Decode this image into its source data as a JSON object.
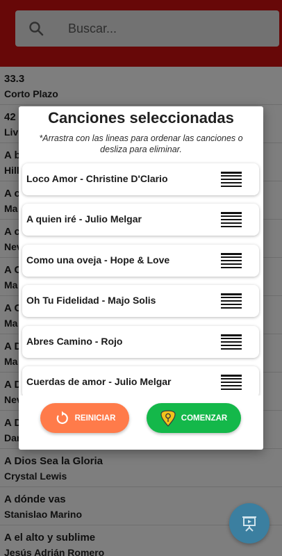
{
  "search": {
    "placeholder": "Buscar..."
  },
  "colors": {
    "header": "#b10f0f",
    "reset": "#ff7b4a",
    "start": "#14b84a",
    "fab": "#3b7fa0"
  },
  "song_list": [
    {
      "title": "33.3",
      "artist": "Corto Plazo"
    },
    {
      "title": "42",
      "artist": "Liv"
    },
    {
      "title": "A b",
      "artist": "Hill"
    },
    {
      "title": "A c",
      "artist": "Ma"
    },
    {
      "title": "A c",
      "artist": "Nev"
    },
    {
      "title": "A C",
      "artist": "Ma"
    },
    {
      "title": "A C",
      "artist": "Ma"
    },
    {
      "title": "A D",
      "artist": "Ma"
    },
    {
      "title": "A D",
      "artist": "Nev"
    },
    {
      "title": "A D",
      "artist": "Dan"
    },
    {
      "title": "A Dios Sea la Gloria",
      "artist": "Crystal Lewis"
    },
    {
      "title": "A dónde vas",
      "artist": "Stanislao Marino"
    },
    {
      "title": "A el alto y sublime",
      "artist": "Jesús Adrián Romero"
    }
  ],
  "dialog": {
    "title": "Canciones seleccionadas",
    "hint": "*Arrastra con las lineas para ordenar las canciones o desliza para eliminar.",
    "items": [
      "Loco Amor - Christine D'Clario",
      "A quien iré - Julio Melgar",
      "Como una oveja - Hope & Love",
      "Oh Tu Fidelidad - Majo Solis",
      "Abres Camino - Rojo",
      "Cuerdas de amor - Julio Melgar"
    ],
    "reset_label": "REINICIAR",
    "start_label": "COMENZAR"
  },
  "icons": {
    "search": "search-icon",
    "reset": "refresh-icon",
    "start": "guitar-pick-icon",
    "fab": "presentation-icon",
    "handle": "drag-handle-icon"
  }
}
